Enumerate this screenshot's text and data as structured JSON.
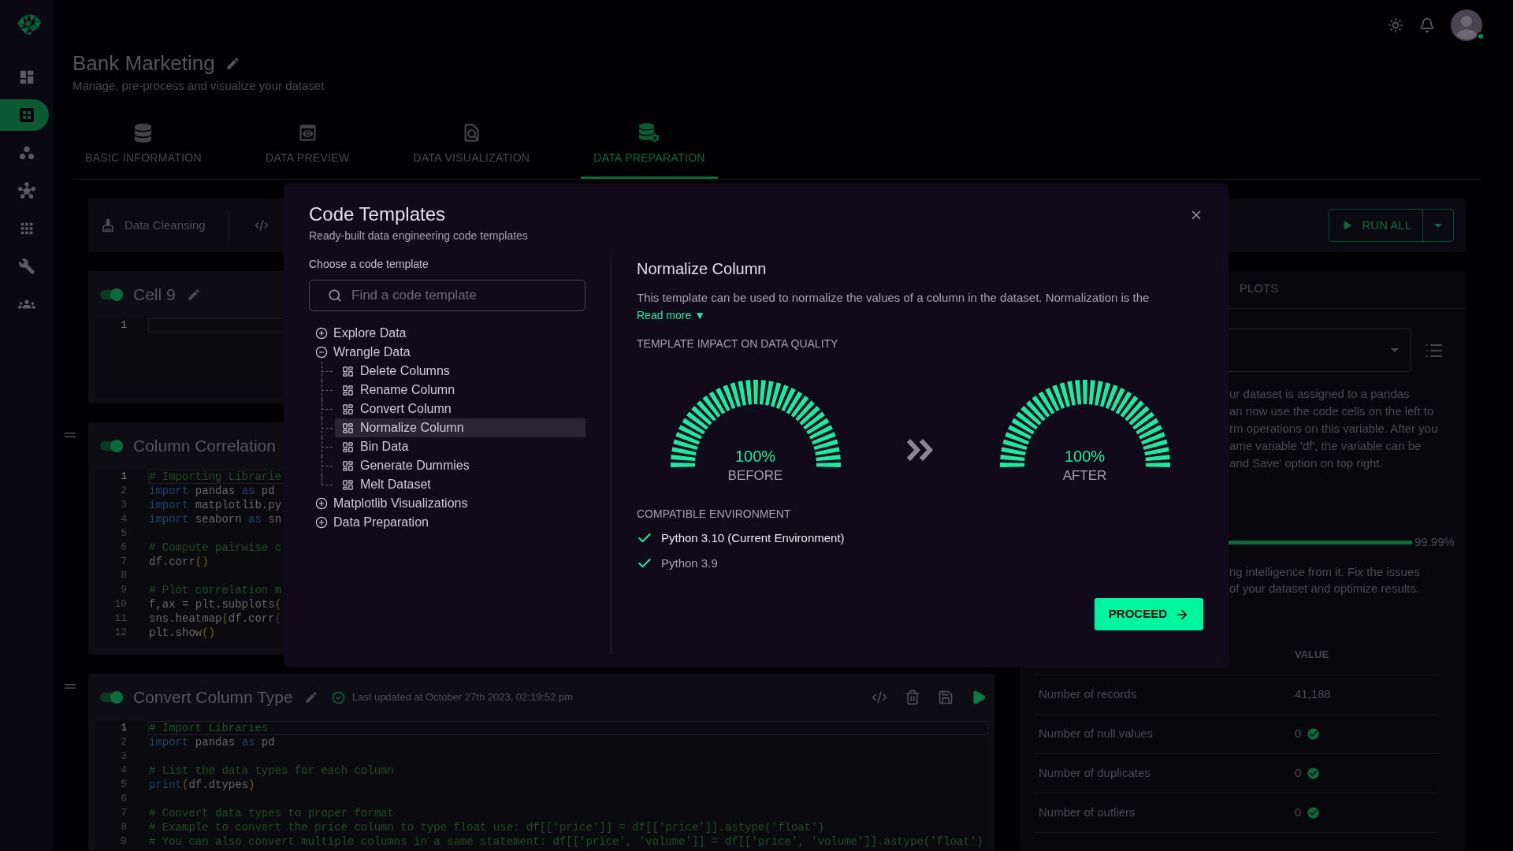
{
  "sidebar": {
    "items": [
      {
        "kind": "dashboard",
        "selected": false
      },
      {
        "kind": "table",
        "selected": true
      },
      {
        "kind": "cluster",
        "selected": false
      },
      {
        "kind": "network",
        "selected": false
      },
      {
        "kind": "apps",
        "selected": false
      },
      {
        "kind": "tools",
        "selected": false
      },
      {
        "kind": "people",
        "selected": false
      }
    ]
  },
  "topbar": {
    "user": {
      "online": true
    }
  },
  "header": {
    "title": "Bank Marketing",
    "subtitle": "Manage, pre-process and visualize your dataset"
  },
  "tabs": [
    {
      "label": "BASIC INFORMATION",
      "kind": "database",
      "selected": false
    },
    {
      "label": "DATA PREVIEW",
      "kind": "preview",
      "selected": false
    },
    {
      "label": "DATA VISUALIZATION",
      "kind": "report",
      "selected": false
    },
    {
      "label": "DATA PREPARATION",
      "kind": "database-gear",
      "selected": true
    }
  ],
  "toolbar": {
    "items": [
      {
        "kind": "broom",
        "label": "Data Cleansing"
      },
      {
        "kind": "code"
      }
    ],
    "run_button": {
      "label": "RUN ALL"
    }
  },
  "cells": [
    {
      "title": "Cell 9",
      "enabled": true,
      "draggable": false,
      "editable": true,
      "lines": [
        {
          "number": "1",
          "active": true
        }
      ]
    },
    {
      "title": "Column Correlation",
      "enabled": true,
      "draggable": true,
      "lines": [
        {
          "number": "1",
          "active": true,
          "tokens": [
            {
              "kind": "comment",
              "text": "# Importing Librarie"
            }
          ]
        },
        {
          "number": "2",
          "active": false,
          "tokens": [
            {
              "kind": "keyword",
              "text": "import"
            },
            {
              "kind": "plain",
              "text": " pandas "
            },
            {
              "kind": "keyword",
              "text": "as"
            },
            {
              "kind": "plain",
              "text": " pd"
            }
          ]
        },
        {
          "number": "3",
          "active": false,
          "tokens": [
            {
              "kind": "keyword",
              "text": "import"
            },
            {
              "kind": "plain",
              "text": " matplotlib.py"
            }
          ]
        },
        {
          "number": "4",
          "active": false,
          "tokens": [
            {
              "kind": "keyword",
              "text": "import"
            },
            {
              "kind": "plain",
              "text": " seaborn "
            },
            {
              "kind": "keyword",
              "text": "as"
            },
            {
              "kind": "plain",
              "text": " sn"
            }
          ]
        },
        {
          "number": "5",
          "active": false
        },
        {
          "number": "6",
          "active": false,
          "tokens": [
            {
              "kind": "comment",
              "text": "# Compute pairwise c"
            }
          ]
        },
        {
          "number": "7",
          "active": false,
          "tokens": [
            {
              "kind": "plain",
              "text": "df.corr"
            },
            {
              "kind": "paren",
              "text": "()"
            }
          ]
        },
        {
          "number": "8",
          "active": false
        },
        {
          "number": "9",
          "active": false,
          "tokens": [
            {
              "kind": "comment",
              "text": "# Plot correlation m"
            }
          ]
        },
        {
          "number": "10",
          "active": false,
          "tokens": [
            {
              "kind": "plain",
              "text": "f,ax = plt.subplots"
            },
            {
              "kind": "paren",
              "text": "("
            }
          ]
        },
        {
          "number": "11",
          "active": false,
          "tokens": [
            {
              "kind": "plain",
              "text": "sns.heatmap"
            },
            {
              "kind": "paren",
              "text": "("
            },
            {
              "kind": "plain",
              "text": "df.corr"
            },
            {
              "kind": "paren2",
              "text": "("
            }
          ]
        },
        {
          "number": "12",
          "active": false,
          "tokens": [
            {
              "kind": "plain",
              "text": "plt.show"
            },
            {
              "kind": "paren",
              "text": "()"
            }
          ]
        }
      ]
    },
    {
      "title": "Convert Column Type",
      "enabled": true,
      "draggable": true,
      "editable": true,
      "status": "Last updated at October 27th 2023, 02:19:52 pm",
      "actions": [
        {
          "kind": "code"
        },
        {
          "kind": "delete"
        },
        {
          "kind": "save"
        },
        {
          "kind": "run"
        }
      ],
      "lines": [
        {
          "number": "1",
          "active": true,
          "tokens": [
            {
              "kind": "comment",
              "text": "# Import Libraries"
            }
          ]
        },
        {
          "number": "2",
          "active": false,
          "tokens": [
            {
              "kind": "keyword",
              "text": "import"
            },
            {
              "kind": "plain",
              "text": " pandas "
            },
            {
              "kind": "keyword",
              "text": "as"
            },
            {
              "kind": "plain",
              "text": " pd"
            }
          ]
        },
        {
          "number": "3",
          "active": false
        },
        {
          "number": "4",
          "active": false,
          "tokens": [
            {
              "kind": "comment",
              "text": "# List the data types for each column"
            }
          ]
        },
        {
          "number": "5",
          "active": false,
          "tokens": [
            {
              "kind": "keyword",
              "text": "print"
            },
            {
              "kind": "paren",
              "text": "("
            },
            {
              "kind": "plain",
              "text": "df.dtypes"
            },
            {
              "kind": "paren",
              "text": ")"
            }
          ]
        },
        {
          "number": "6",
          "active": false
        },
        {
          "number": "7",
          "active": false,
          "tokens": [
            {
              "kind": "comment",
              "text": "# Convert data types to proper format"
            }
          ]
        },
        {
          "number": "8",
          "active": false,
          "tokens": [
            {
              "kind": "comment",
              "text": "# Example to convert the price column to type float use: df[['price']] = df[['price']].astype('float')"
            }
          ]
        },
        {
          "number": "9",
          "active": false,
          "tokens": [
            {
              "kind": "comment",
              "text": "# You can also convert multiple columns in a same statement: df[['price', 'volume']] = df[['price', 'volume']].astype('float')"
            }
          ]
        }
      ]
    }
  ],
  "side_panel": {
    "tabs": [
      {
        "label": "PLOTS",
        "selected": false
      }
    ],
    "intro_lines": [
      "ur dataset is assigned to a pandas",
      "an now use the code cells on the left to",
      "rm operations on this variable. After you",
      "ame variable 'df', the variable can be",
      "and Save' option on top right."
    ],
    "quality": {
      "level": 0.9999,
      "reading": "99.99%"
    },
    "advice_lines": [
      "ng intelligence from it. Fix the issues",
      "of your dataset and optimize results."
    ],
    "table": {
      "value_heading": "VALUE",
      "rows": [
        {
          "label": "Number of records",
          "value": "41,188",
          "verified": false
        },
        {
          "label": "Number of null values",
          "value": "0",
          "verified": true
        },
        {
          "label": "Number of duplicates",
          "value": "0",
          "verified": true
        },
        {
          "label": "Number of outliers",
          "value": "0",
          "verified": true
        }
      ]
    }
  },
  "modal": {
    "title": "Code Templates",
    "subtitle": "Ready-built data engineering code templates",
    "picker_label": "Choose a code template",
    "search": {
      "placeholder": "Find a code template"
    },
    "tree": [
      {
        "label": "Explore Data",
        "expanded": false
      },
      {
        "label": "Wrangle Data",
        "expanded": true,
        "children": [
          {
            "label": "Delete Columns",
            "selected": false
          },
          {
            "label": "Rename Column",
            "selected": false
          },
          {
            "label": "Convert Column",
            "selected": false
          },
          {
            "label": "Normalize Column",
            "selected": true
          },
          {
            "label": "Bin Data",
            "selected": false
          },
          {
            "label": "Generate Dummies",
            "selected": false
          },
          {
            "label": "Melt Dataset",
            "selected": false
          }
        ]
      },
      {
        "label": "Matplotlib Visualizations",
        "expanded": false
      },
      {
        "label": "Data Preparation",
        "expanded": false
      }
    ],
    "detail": {
      "title": "Normalize Column",
      "description": "This template can be used to normalize the values of a column in the dataset. Normalization is the",
      "read_more": "Read more ▼",
      "impact_label": "TEMPLATE IMPACT ON DATA QUALITY",
      "gauges": [
        {
          "level": 1,
          "value": "100%",
          "label": "BEFORE"
        },
        {
          "level": 1,
          "value": "100%",
          "label": "AFTER"
        }
      ],
      "environments_label": "COMPATIBLE ENVIRONMENT",
      "environments": [
        {
          "label": "Python 3.10 (Current Environment)",
          "current": true
        },
        {
          "label": "Python 3.9",
          "current": false
        }
      ],
      "proceed": "PROCEED"
    }
  }
}
